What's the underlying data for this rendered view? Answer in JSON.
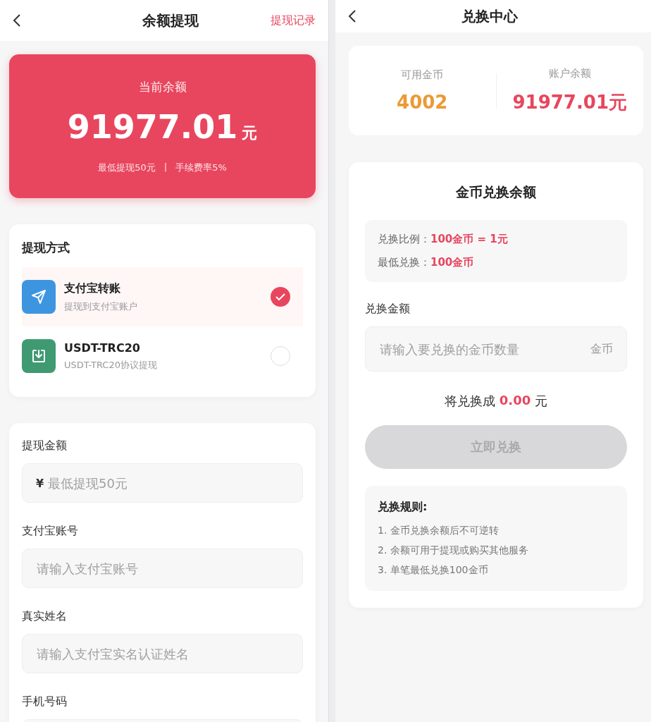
{
  "withdraw": {
    "header": {
      "title": "余额提现",
      "action": "提现记录"
    },
    "balance": {
      "label": "当前余额",
      "amount": "91977.01",
      "unit": "元",
      "min_note": "最低提现50元",
      "separator": "|",
      "fee_note": "手续费率5%"
    },
    "methods": {
      "title": "提现方式",
      "items": [
        {
          "kind": "send",
          "color": "#3d95e0",
          "name": "支付宝转账",
          "desc": "提现到支付宝账户",
          "selected": true
        },
        {
          "kind": "download",
          "color": "#3f9a72",
          "name": "USDT-TRC20",
          "desc": "USDT-TRC20协议提现",
          "selected": false
        }
      ]
    },
    "form": [
      {
        "label": "提现金额",
        "prefix": "¥",
        "placeholder": "最低提现50元"
      },
      {
        "label": "支付宝账号",
        "placeholder": "请输入支付宝账号"
      },
      {
        "label": "真实姓名",
        "placeholder": "请输入支付宝实名认证姓名"
      },
      {
        "label": "手机号码"
      }
    ]
  },
  "exchange": {
    "header": {
      "title": "兑换中心"
    },
    "stats": [
      {
        "kind": "coins",
        "label": "可用金币",
        "value": "4002"
      },
      {
        "kind": "money",
        "label": "账户余额",
        "value": "91977.01元"
      }
    ],
    "card": {
      "title": "金币兑换余额",
      "info": [
        {
          "label": "兑换比例：",
          "value": "100金币 = 1元"
        },
        {
          "label": "最低兑换：",
          "value": "100金币"
        }
      ],
      "field": {
        "label": "兑换金额",
        "placeholder": "请输入要兑换的金币数量",
        "unit": "金币"
      },
      "result": {
        "prefix": "将兑换成",
        "amount": "0.00",
        "suffix": "元"
      },
      "button": {
        "label": "立即兑换",
        "disabled": true
      },
      "rules": {
        "title": "兑换规则:",
        "items": [
          "1. 金币兑换余额后不可逆转",
          "2. 余额可用于提现或购买其他服务",
          "3. 单笔最低兑换100金币"
        ]
      }
    }
  }
}
